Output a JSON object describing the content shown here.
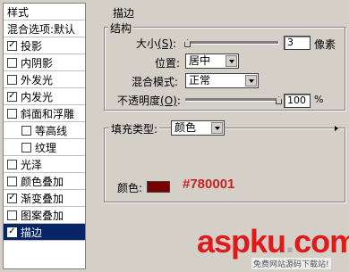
{
  "sidebar": {
    "header": "样式",
    "blend_options": "混合选项:默认",
    "items": [
      {
        "label": "投影",
        "checked": true
      },
      {
        "label": "内阴影",
        "checked": false
      },
      {
        "label": "外发光",
        "checked": false
      },
      {
        "label": "内发光",
        "checked": true
      },
      {
        "label": "斜面和浮雕",
        "checked": false
      },
      {
        "label": "等高线",
        "checked": false
      },
      {
        "label": "纹理",
        "checked": false
      },
      {
        "label": "光泽",
        "checked": false
      },
      {
        "label": "颜色叠加",
        "checked": false
      },
      {
        "label": "渐变叠加",
        "checked": true
      },
      {
        "label": "图案叠加",
        "checked": false
      },
      {
        "label": "描边",
        "checked": true
      }
    ],
    "check_glyph": "✓"
  },
  "stroke": {
    "section_title": "描边",
    "structure_title": "结构",
    "size_label": "大小",
    "size_key": "(S)",
    "size_value": "3",
    "size_unit": "像素",
    "position_label": "位置",
    "position_value": "居中",
    "blend_label": "混合模式",
    "blend_value": "正常",
    "opacity_label": "不透明度",
    "opacity_key": "(O)",
    "opacity_value": "100",
    "opacity_unit": "%",
    "size_slider_level": 0.02,
    "opacity_slider_level": 1.0,
    "fill_type_label": "填充类型",
    "fill_type_value": "颜色",
    "color_label": "颜色",
    "color_hex": "#780001",
    "color_swatch": "#780001"
  },
  "watermark": {
    "brand": "aspku",
    "dot": ".",
    "tld": "com",
    "sub": "免费网站源码下载站!"
  }
}
